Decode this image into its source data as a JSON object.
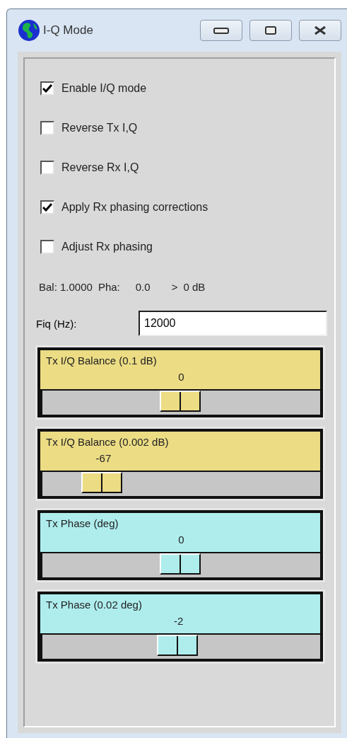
{
  "window": {
    "title": "I-Q Mode"
  },
  "checkboxes": [
    {
      "label": "Enable I/Q mode",
      "checked": true
    },
    {
      "label": "Reverse Tx I,Q",
      "checked": false
    },
    {
      "label": "Reverse Rx I,Q",
      "checked": false
    },
    {
      "label": "Apply Rx phasing corrections",
      "checked": true
    },
    {
      "label": "Adjust Rx phasing",
      "checked": false
    }
  ],
  "status": [
    "Bal: 1.0000",
    "Pha:",
    "0.0",
    ">",
    "0 dB"
  ],
  "fiq": {
    "label": "Fiq (Hz):",
    "value": "12000"
  },
  "sliders": [
    {
      "title": "Tx I/Q Balance (0.1 dB)",
      "reading": "0",
      "level": 0.5,
      "color": "#ecdc84"
    },
    {
      "title": "Tx I/Q Balance (0.002 dB)",
      "reading": "-67",
      "level": 0.22,
      "color": "#ecdc84"
    },
    {
      "title": "Tx Phase (deg)",
      "reading": "0",
      "level": 0.5,
      "color": "#afeded"
    },
    {
      "title": "Tx Phase (0.02 deg)",
      "reading": "-2",
      "level": 0.49,
      "color": "#afeded"
    }
  ]
}
